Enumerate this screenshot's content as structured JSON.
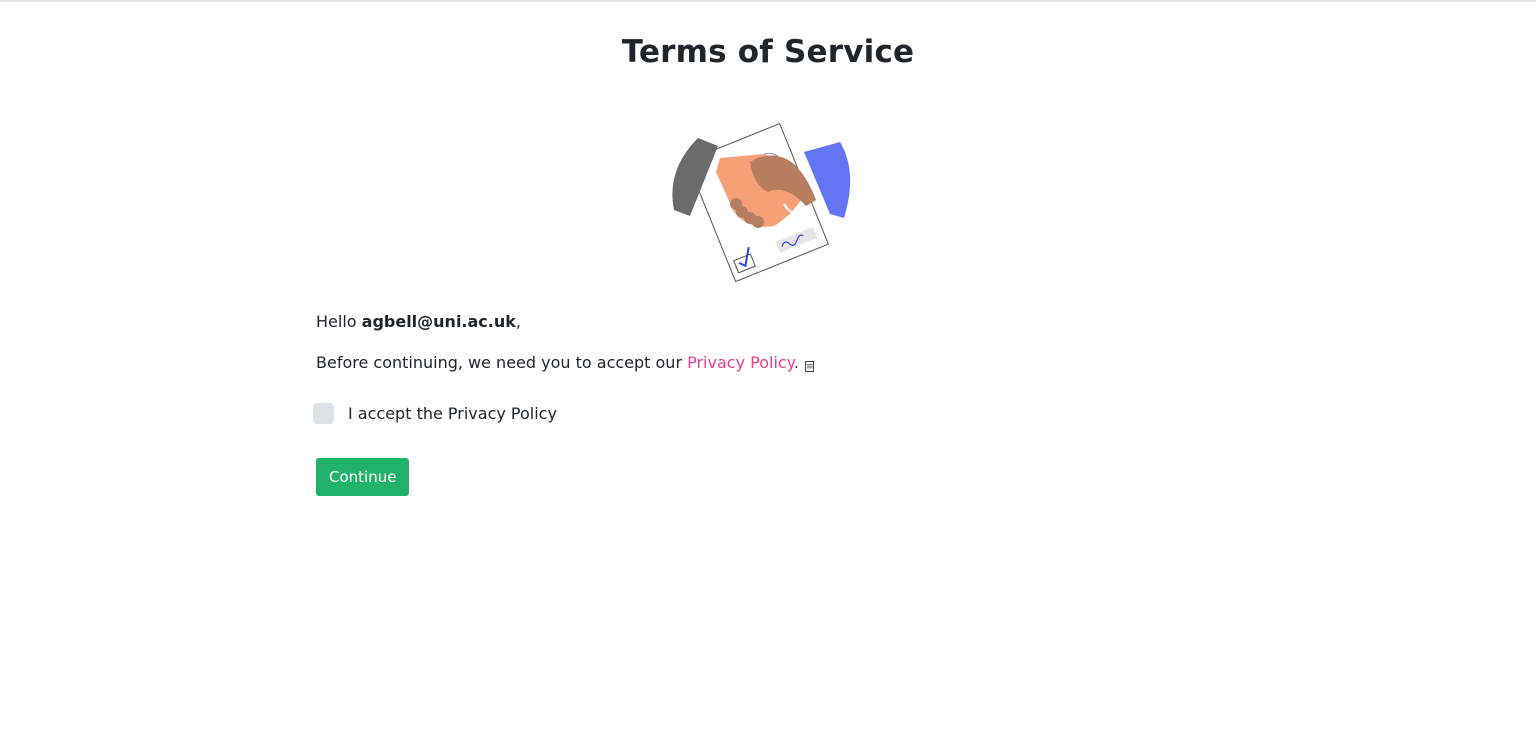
{
  "page": {
    "title": "Terms of Service"
  },
  "illustration": {
    "icon": "handshake-agreement-icon",
    "colors": {
      "sleeve_left": "#6b6b6b",
      "sleeve_right": "#6475f4",
      "hand_light": "#f7a078",
      "hand_dark": "#b67d5f",
      "ink": "#3242e0"
    }
  },
  "message": {
    "greeting_prefix": "Hello ",
    "email": "agbell@uni.ac.uk",
    "greeting_suffix": ",",
    "notice_prefix": "Before continuing, we need you to accept our ",
    "privacy_link_label": "Privacy Policy",
    "notice_suffix": ".",
    "notice_icon": "external-document-icon"
  },
  "consent": {
    "checkbox_label": "I accept the Privacy Policy",
    "checked": false
  },
  "actions": {
    "continue_label": "Continue"
  },
  "colors": {
    "link": "#e83e8c",
    "primary_button": "#21b26a",
    "checkbox": "#dee2e6",
    "text": "#212529"
  }
}
